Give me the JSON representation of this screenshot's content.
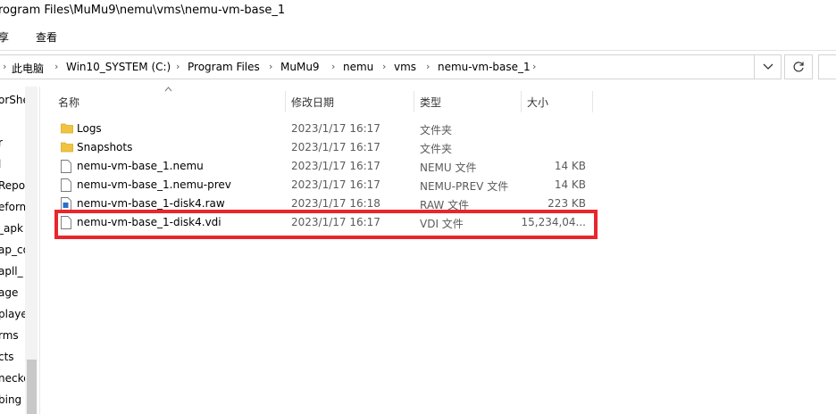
{
  "window": {
    "title": "rogram Files\\MuMu9\\nemu\\vms\\nemu-vm-base_1"
  },
  "menu": {
    "share": "享",
    "view": "查看"
  },
  "address": {
    "crumbs": [
      "此电脑",
      "Win10_SYSTEM (C:)",
      "Program Files",
      "MuMu9",
      "nemu",
      "vms",
      "nemu-vm-base_1"
    ],
    "separator": "›"
  },
  "nav": {
    "items": [
      "orShe",
      "r",
      "l",
      "Repo",
      "eform",
      "_apk",
      "ap_co",
      "apll_",
      "age",
      "playe",
      "rms",
      "cts",
      "necke",
      "bing"
    ]
  },
  "columns": {
    "name": "名称",
    "date": "修改日期",
    "type": "类型",
    "size": "大小"
  },
  "files": [
    {
      "name": "Logs",
      "date": "2023/1/17 16:17",
      "type": "文件夹",
      "size": "",
      "icon": "folder-icon"
    },
    {
      "name": "Snapshots",
      "date": "2023/1/17 16:17",
      "type": "文件夹",
      "size": "",
      "icon": "folder-icon"
    },
    {
      "name": "nemu-vm-base_1.nemu",
      "date": "2023/1/17 16:17",
      "type": "NEMU 文件",
      "size": "14 KB",
      "icon": "file-icon"
    },
    {
      "name": "nemu-vm-base_1.nemu-prev",
      "date": "2023/1/17 16:17",
      "type": "NEMU-PREV 文件",
      "size": "14 KB",
      "icon": "file-icon"
    },
    {
      "name": "nemu-vm-base_1-disk4.raw",
      "date": "2023/1/17 16:18",
      "type": "RAW 文件",
      "size": "223 KB",
      "icon": "raw-file-icon"
    },
    {
      "name": "nemu-vm-base_1-disk4.vdi",
      "date": "2023/1/17 16:17",
      "type": "VDI 文件",
      "size": "15,234,04...",
      "icon": "file-icon"
    }
  ],
  "colors": {
    "highlight": "#e8262c",
    "folder": "#f0c440"
  }
}
